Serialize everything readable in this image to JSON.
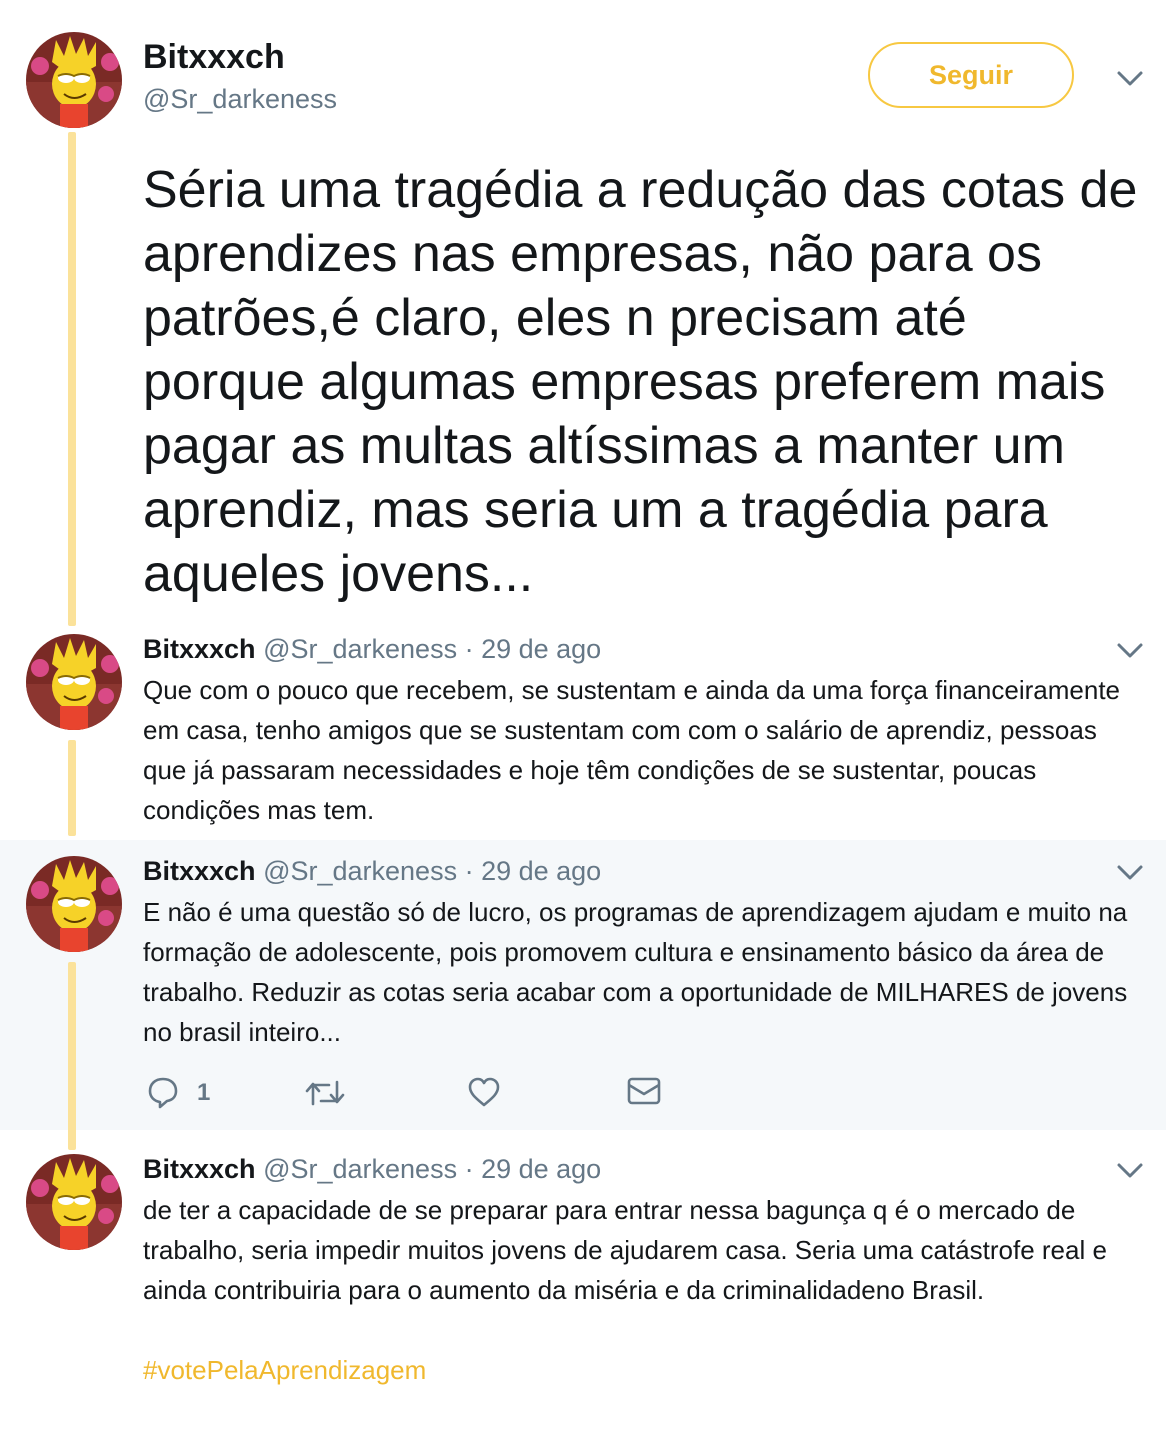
{
  "main_tweet": {
    "name": "Bitxxxch",
    "handle": "@Sr_darkeness",
    "follow_label": "Seguir",
    "text": "Séria uma tragédia a redução das cotas de aprendizes nas empresas, não para os patrões,é claro, eles n precisam até porque algumas empresas preferem mais pagar as multas altíssimas a manter um aprendiz, mas seria um a tragédia para aqueles jovens..."
  },
  "replies": [
    {
      "name": "Bitxxxch",
      "handle": "@Sr_darkeness",
      "date": "· 29 de ago",
      "text": "Que com o pouco que recebem, se sustentam e ainda da uma força financeiramente  em casa, tenho amigos que se sustentam com com o salário de aprendiz, pessoas que já passaram necessidades e hoje têm condições de se sustentar, poucas condições mas tem."
    },
    {
      "name": "Bitxxxch",
      "handle": "@Sr_darkeness",
      "date": "· 29 de ago",
      "text": "E não é uma questão só de lucro, os programas de aprendizagem ajudam e muito na formação de adolescente, pois promovem cultura e ensinamento básico da área de trabalho. Reduzir as cotas seria acabar com a oportunidade de MILHARES de jovens no brasil inteiro...",
      "reply_count": "1"
    },
    {
      "name": "Bitxxxch",
      "handle": "@Sr_darkeness",
      "date": "· 29 de ago",
      "text": "de ter a capacidade de se preparar para entrar nessa bagunça q é o mercado de trabalho, seria impedir muitos jovens de ajudarem casa. Seria uma catástrofe real e ainda contribuiria para o aumento da miséria e da criminalidadeno Brasil.",
      "hashtag": "#votePelaAprendizagem"
    }
  ],
  "colors": {
    "accent": "#f0b82d",
    "thread_line": "#fbe29a",
    "muted": "#657786",
    "highlight_bg": "#f5f8fa"
  },
  "icons": [
    "avatar-lisa-simpson",
    "chevron-down-icon",
    "reply-icon",
    "retweet-icon",
    "like-icon",
    "direct-message-icon"
  ]
}
